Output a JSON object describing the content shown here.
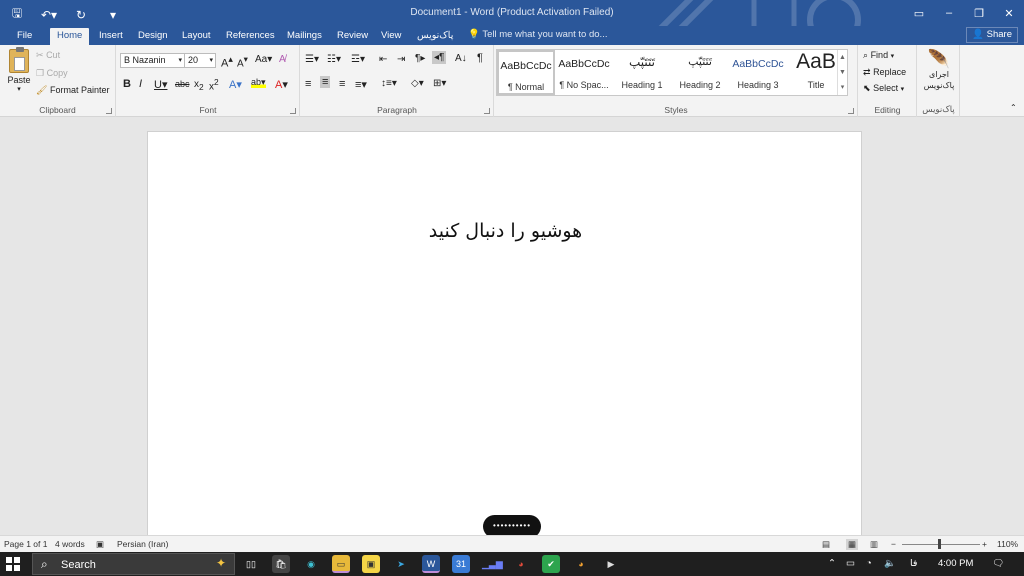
{
  "title_bar": {
    "document_title": "Document1 - Word (Product Activation Failed)"
  },
  "tabs": [
    {
      "label": "File"
    },
    {
      "label": "Home",
      "active": true
    },
    {
      "label": "Insert"
    },
    {
      "label": "Design"
    },
    {
      "label": "Layout"
    },
    {
      "label": "References"
    },
    {
      "label": "Mailings"
    },
    {
      "label": "Review"
    },
    {
      "label": "View"
    },
    {
      "label": "پاک‌نویس"
    }
  ],
  "tell_me": "Tell me what you want to do...",
  "share": "Share",
  "clipboard": {
    "paste": "Paste",
    "cut": "Cut",
    "copy": "Copy",
    "format_painter": "Format Painter",
    "label": "Clipboard"
  },
  "font": {
    "name": "B Nazanin",
    "size": "20",
    "label": "Font"
  },
  "paragraph": {
    "label": "Paragraph"
  },
  "styles": {
    "label": "Styles",
    "items": [
      {
        "preview": "AaBbCcDc",
        "name": "¶ Normal"
      },
      {
        "preview": "AaBbCcDc",
        "name": "¶ No Spac..."
      },
      {
        "preview": "تَتَتَپّپ",
        "name": "Heading 1"
      },
      {
        "preview": "تَتَتَپّپ",
        "name": "Heading 2"
      },
      {
        "preview": "AaBbCcDc",
        "name": "Heading 3"
      },
      {
        "preview": "AaB",
        "name": "Title"
      }
    ]
  },
  "editing": {
    "find": "Find",
    "replace": "Replace",
    "select": "Select",
    "label": "Editing"
  },
  "paknevis": {
    "run": "اجرای پاک‌نویس",
    "label": "پاک‌نویس"
  },
  "document": {
    "text": "هوشیو را دنبال کنید"
  },
  "status": {
    "page": "Page 1 of 1",
    "words": "4 words",
    "language": "Persian (Iran)",
    "zoom": "110%"
  },
  "taskbar": {
    "search": "Search",
    "lang": "فا",
    "time": "4:00 PM"
  },
  "colors": {
    "accent": "#2b579a",
    "ribbon_bg": "#f3f3f3",
    "taskbar_bg": "#1f1f1f"
  }
}
